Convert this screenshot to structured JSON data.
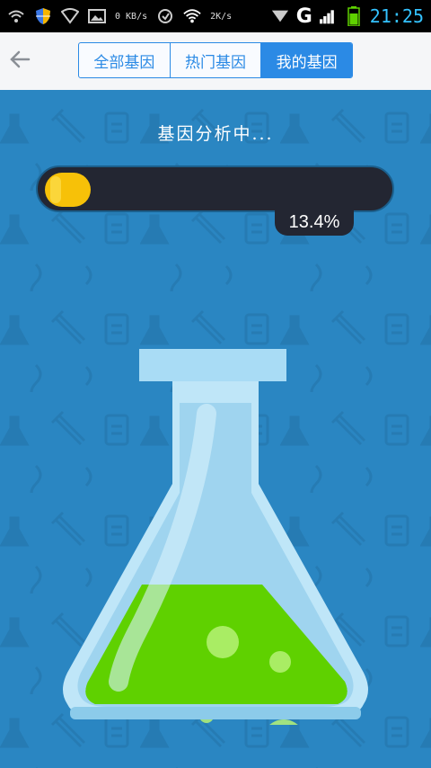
{
  "status_bar": {
    "speed_up": "0 KB/s",
    "speed_down": "2K/s",
    "network": "G",
    "time": "21:25",
    "icons": [
      "wifi-icon",
      "shield-icon",
      "wifi-icon",
      "image-icon",
      "network-icon",
      "wifi-icon",
      "signal-icon",
      "battery-icon"
    ]
  },
  "app_bar": {
    "back_icon": "arrow-left-icon",
    "tabs": [
      {
        "label": "全部基因",
        "active": false
      },
      {
        "label": "热门基因",
        "active": false
      },
      {
        "label": "我的基因",
        "active": true
      }
    ]
  },
  "main": {
    "title": "基因分析中...",
    "progress_percent": 13.4,
    "progress_label": "13.4%"
  },
  "colors": {
    "background": "#2a86c2",
    "accent": "#2b8ae5",
    "progress_fill": "#f7c108",
    "progress_track": "#232632",
    "liquid": "#5fd100",
    "flask_glass": "#a9dcf5"
  }
}
